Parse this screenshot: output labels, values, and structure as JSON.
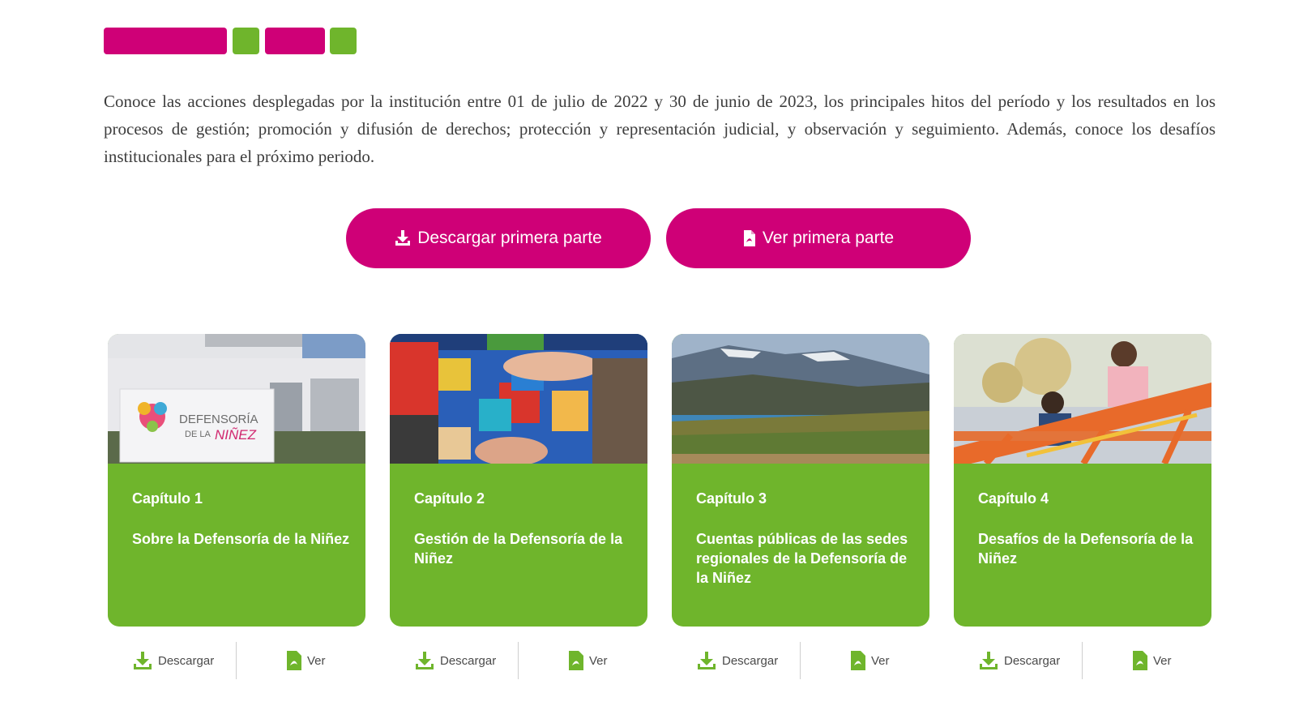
{
  "colors": {
    "accent_pink": "#cf0077",
    "accent_green": "#6fb52c"
  },
  "intro_text": "Conoce las acciones desplegadas por la institución entre 01 de julio de 2022 y 30 de junio de 2023, los principales hitos del período y los resultados en los procesos de gestión; promoción y difusión de derechos; protección y representación judicial, y observación y seguimiento. Además, conoce los desafíos institucionales para el próximo periodo.",
  "buttons": {
    "download_first": {
      "label": "Descargar primera parte",
      "icon": "download-icon"
    },
    "view_first": {
      "label": "Ver primera parte",
      "icon": "pdf-icon"
    }
  },
  "cards": [
    {
      "chapter": "Capítulo 1",
      "title": "Sobre la Defensoría de la Niñez",
      "image": "building-sign-photo",
      "logo_text": "DEFENSORÍA",
      "logo_text_small": "DE LA",
      "logo_text_accent": "NIÑEZ"
    },
    {
      "chapter": "Capítulo 2",
      "title": "Gestión de la Defensoría de la Niñez",
      "image": "toy-blocks-photo"
    },
    {
      "chapter": "Capítulo 3",
      "title": "Cuentas públicas de las sedes regionales de la Defensoría de la Niñez",
      "image": "landscape-photo"
    },
    {
      "chapter": "Capítulo 4",
      "title": "Desafíos de la Defensoría de la Niñez",
      "image": "children-playground-photo"
    }
  ],
  "card_actions": {
    "download_label": "Descargar",
    "view_label": "Ver"
  }
}
